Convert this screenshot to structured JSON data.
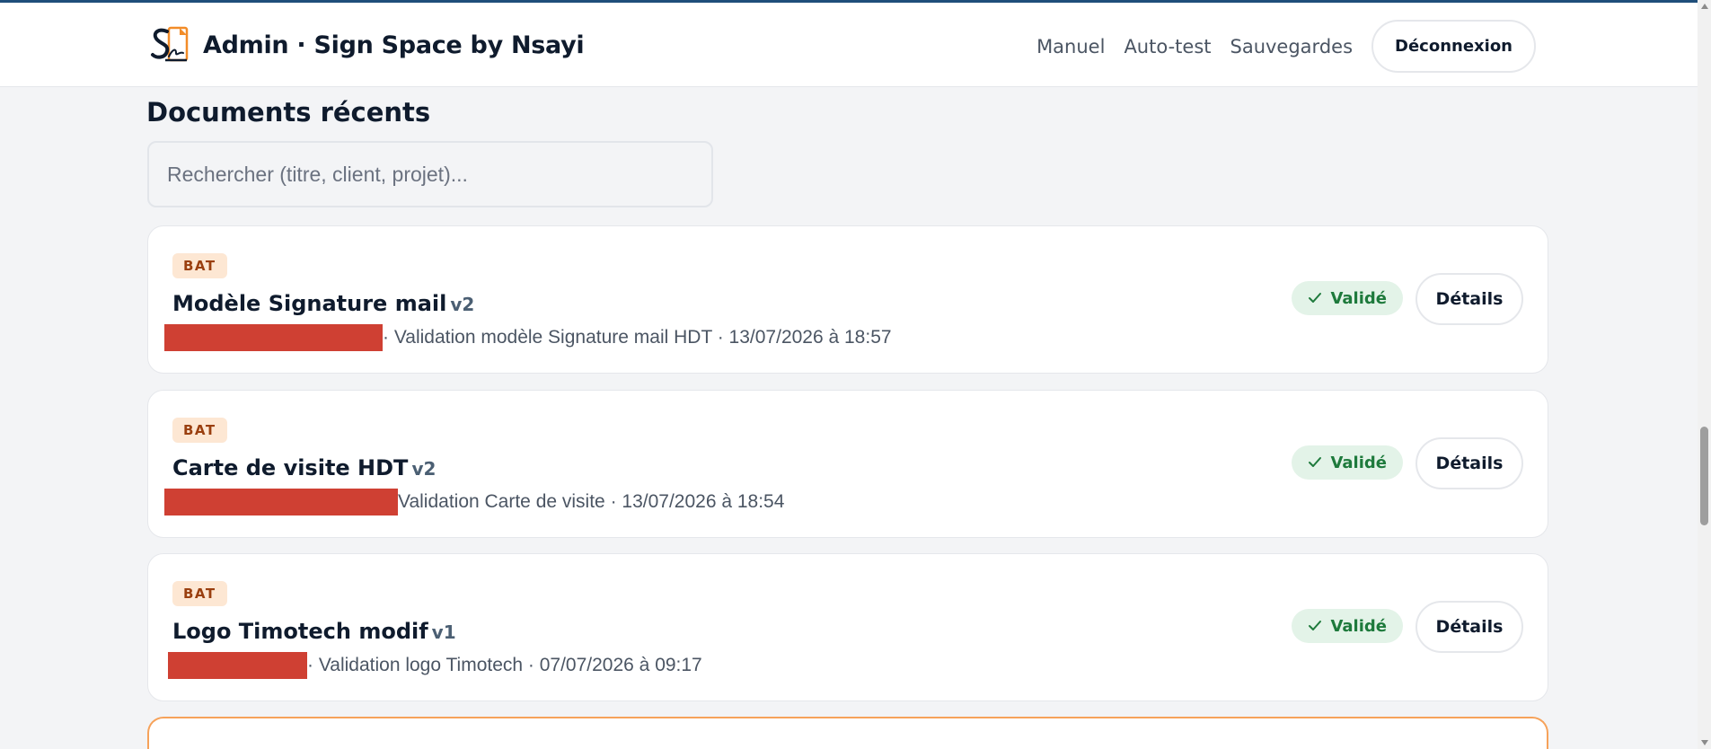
{
  "header": {
    "title": "Admin · Sign Space by Nsayi",
    "nav": [
      "Manuel",
      "Auto-test",
      "Sauvegardes"
    ],
    "logout_label": "Déconnexion"
  },
  "main": {
    "section_title": "Documents récents",
    "search_placeholder": "Rechercher (titre, client, projet)...",
    "documents": [
      {
        "type": "BAT",
        "title": "Modèle Signature mail",
        "version": "v2",
        "meta": "· Validation modèle Signature mail HDT · 13/07/2026 à 18:57",
        "status": "Validé",
        "details_label": "Détails"
      },
      {
        "type": "BAT",
        "title": "Carte de visite HDT",
        "version": "v2",
        "meta": "Validation Carte de visite · 13/07/2026 à 18:54",
        "status": "Validé",
        "details_label": "Détails"
      },
      {
        "type": "BAT",
        "title": "Logo Timotech modif",
        "version": "v1",
        "meta": "· Validation logo Timotech · 07/07/2026 à 09:17",
        "status": "Validé",
        "details_label": "Détails"
      }
    ]
  },
  "colors": {
    "header_strip": "#1f4e7a",
    "badge_bg": "#fde7d3",
    "status_bg": "#e3f3e8",
    "status_text": "#1e7a3c",
    "redaction": "#cf4033",
    "highlight_border": "#f6a25a"
  },
  "icons": [
    "sign-space-logo",
    "check-icon"
  ]
}
